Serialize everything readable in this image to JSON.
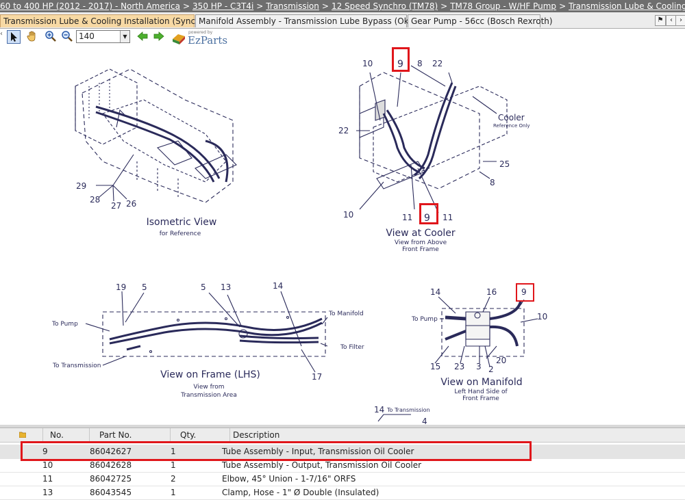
{
  "breadcrumb": [
    {
      "label": "60 to 400 HP (2012 - 2017) - North America"
    },
    {
      "label": "350 HP - C3T4i"
    },
    {
      "label": "Transmission"
    },
    {
      "label": "12 Speed Synchro (TM78)"
    },
    {
      "label": "TM78 Group - W/HF Pump"
    },
    {
      "label": "Transmission Lube & Cooling Installation (Sy"
    }
  ],
  "tabs": [
    {
      "label": "Transmission Lube & Cooling Installation (Synchro)",
      "active": true
    },
    {
      "label": "Manifold Assembly - Transmission Lube Bypass (Okubo)",
      "active": false
    },
    {
      "label": "Gear Pump - 56cc (Bosch Rexroth)",
      "active": false
    }
  ],
  "toolbar": {
    "zoom_value": "140",
    "logo_powered": "powered by",
    "logo_name": "EzParts"
  },
  "icons": {
    "select": "arrow-pointer-icon",
    "pan": "hand-icon",
    "zoom_in": "zoom-in-icon",
    "zoom_out": "zoom-out-icon",
    "back": "green-left-arrow-icon",
    "forward": "green-right-arrow-icon",
    "logo": "ezparts-logo-icon"
  },
  "colors": {
    "highlight": "#e0161b",
    "active_tab": "#f7d9a4",
    "breadcrumb_bg": "#6e6e6e",
    "line_art": "#2a2a5a"
  },
  "diagram": {
    "views": {
      "isometric_title": "Isometric View",
      "isometric_sub": "for Reference",
      "cooler_title": "View at Cooler",
      "cooler_sub1": "View from Above",
      "cooler_sub2": "Front Frame",
      "frame_title": "View on Frame (LHS)",
      "frame_sub1": "View from",
      "frame_sub2": "Transmission Area",
      "manifold_title": "View on Manifold",
      "manifold_sub1": "Left Hand Side of",
      "manifold_sub2": "Front Frame"
    },
    "labels": {
      "cooler": "Cooler",
      "reference_only": "Reference Only",
      "to_pump": "To Pump",
      "to_transmission": "To Transmission",
      "to_manifold": "To Manifold",
      "to_filter": "To Filter",
      "to_pump_2": "To Pump",
      "to_transmission_2": "To Transmission"
    },
    "callouts": {
      "iso_29": "29",
      "iso_28": "28",
      "iso_27": "27",
      "iso_26": "26",
      "c_10_top": "10",
      "c_9_top": "9",
      "c_8_top": "8",
      "c_22_top": "22",
      "c_22_left": "22",
      "c_25": "25",
      "c_8_right": "8",
      "c_10_bot": "10",
      "c_11_a": "11",
      "c_9_bot": "9",
      "c_11_b": "11",
      "f_19": "19",
      "f_5_a": "5",
      "f_5_b": "5",
      "f_13": "13",
      "f_14": "14",
      "f_17": "17",
      "m_14": "14",
      "m_16": "16",
      "m_9": "9",
      "m_10": "10",
      "m_15": "15",
      "m_23": "23",
      "m_3": "3",
      "m_20": "20",
      "m_2": "2",
      "b_14": "14",
      "b_4": "4"
    }
  },
  "parts_table": {
    "columns": [
      "No.",
      "Part No.",
      "Qty.",
      "Description"
    ],
    "rows": [
      {
        "no": "9",
        "part": "86042627",
        "qty": "1",
        "desc": "Tube Assembly - Input, Transmission Oil Cooler",
        "selected": true
      },
      {
        "no": "10",
        "part": "86042628",
        "qty": "1",
        "desc": "Tube Assembly - Output, Transmission Oil Cooler",
        "selected": false
      },
      {
        "no": "11",
        "part": "86042725",
        "qty": "2",
        "desc": "Elbow, 45° Union - 1-7/16\" ORFS",
        "selected": false
      },
      {
        "no": "13",
        "part": "86043545",
        "qty": "1",
        "desc": "Clamp, Hose - 1\" Ø Double (Insulated)",
        "selected": false
      }
    ]
  }
}
